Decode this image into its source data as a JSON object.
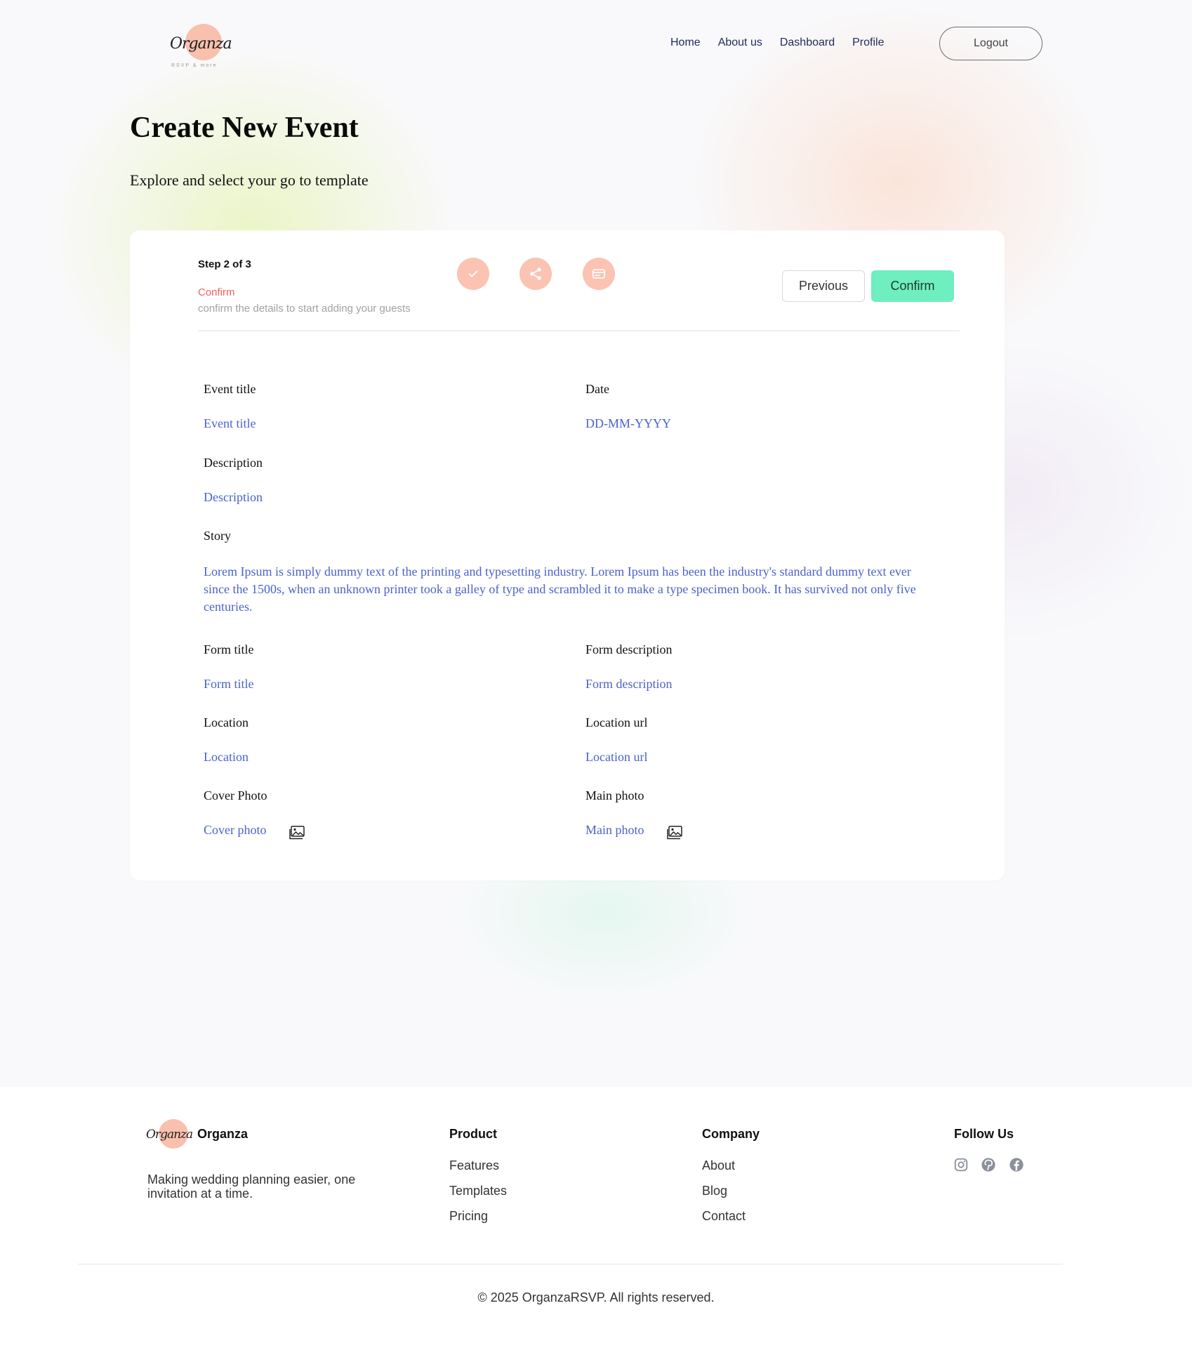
{
  "brand": {
    "logo_text": "Organza",
    "logo_tagline": "RSVP & more",
    "name": "Organza",
    "tagline": "Making wedding planning easier, one invitation at a time."
  },
  "nav": {
    "items": [
      "Home",
      "About us",
      "Dashboard",
      "Profile"
    ],
    "logout_label": "Logout"
  },
  "page": {
    "title": "Create New Event",
    "subtitle": "Explore and select your go to template"
  },
  "wizard": {
    "step_text": "Step 2 of 3",
    "step_name": "Confirm",
    "step_description": "confirm the details to start adding your guests",
    "step_icons": [
      "check-icon",
      "share-icon",
      "card-icon"
    ],
    "previous_label": "Previous",
    "confirm_label": "Confirm"
  },
  "form": {
    "event_title": {
      "label": "Event title",
      "value": "Event title"
    },
    "date": {
      "label": "Date",
      "value": "DD-MM-YYYY"
    },
    "description": {
      "label": "Description",
      "value": "Description"
    },
    "story": {
      "label": "Story",
      "value": "Lorem Ipsum is simply dummy text of the printing and typesetting industry. Lorem Ipsum has been the industry's standard dummy text ever since the 1500s, when an unknown printer took a galley of type and scrambled it to make a type specimen book. It has survived not only five centuries."
    },
    "form_title": {
      "label": "Form title",
      "value": "Form title"
    },
    "form_description": {
      "label": "Form description",
      "value": "Form description"
    },
    "location": {
      "label": "Location",
      "value": "Location"
    },
    "location_url": {
      "label": "Location url",
      "value": "Location url"
    },
    "cover_photo": {
      "label": "Cover Photo",
      "value": "Cover photo"
    },
    "main_photo": {
      "label": "Main photo",
      "value": "Main photo"
    }
  },
  "footer": {
    "product": {
      "heading": "Product",
      "links": [
        "Features",
        "Templates",
        "Pricing"
      ]
    },
    "company": {
      "heading": "Company",
      "links": [
        "About",
        "Blog",
        "Contact"
      ]
    },
    "follow": {
      "heading": "Follow Us",
      "icons": [
        "instagram-icon",
        "pinterest-icon",
        "facebook-icon"
      ]
    },
    "copyright": "© 2025 OrganzaRSVP. All rights reserved."
  },
  "colors": {
    "accent_peach": "#fbc3b2",
    "confirm_green": "#6feebf",
    "value_blue": "#4a63c9",
    "step_red": "#f0625f"
  }
}
